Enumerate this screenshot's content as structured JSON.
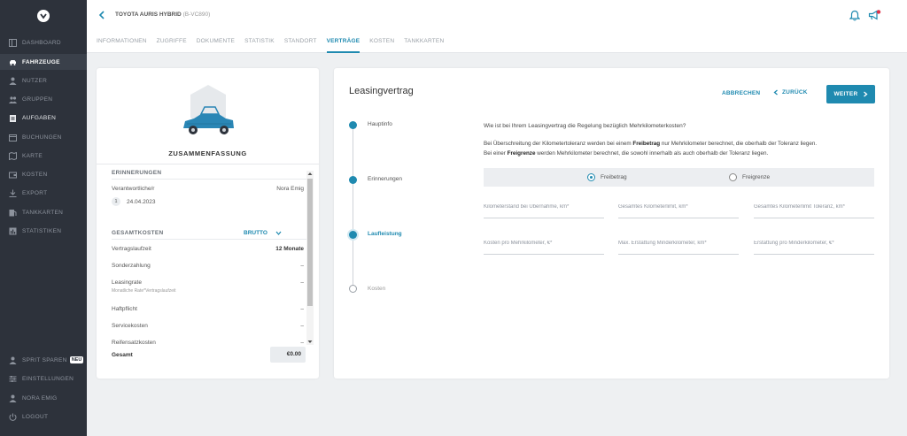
{
  "sidebar": {
    "items": [
      {
        "label": "DASHBOARD",
        "icon": "dashboard-icon"
      },
      {
        "label": "FAHRZEUGE",
        "icon": "car-icon"
      },
      {
        "label": "NUTZER",
        "icon": "user-icon"
      },
      {
        "label": "GRUPPEN",
        "icon": "group-icon"
      },
      {
        "label": "AUFGABEN",
        "icon": "clipboard-icon"
      },
      {
        "label": "BUCHUNGEN",
        "icon": "calendar-icon"
      },
      {
        "label": "KARTE",
        "icon": "map-icon"
      },
      {
        "label": "KOSTEN",
        "icon": "wallet-icon"
      },
      {
        "label": "EXPORT",
        "icon": "download-icon"
      },
      {
        "label": "TANKKARTEN",
        "icon": "fuel-card-icon"
      },
      {
        "label": "STATISTIKEN",
        "icon": "chart-icon"
      }
    ],
    "bottom": [
      {
        "label": "SPRIT SPAREN",
        "badge": "NEU",
        "icon": "user-icon"
      },
      {
        "label": "EINSTELLUNGEN",
        "icon": "sliders-icon"
      },
      {
        "label": "NORA EMIG",
        "icon": "user-icon"
      },
      {
        "label": "LOGOUT",
        "icon": "power-icon"
      }
    ]
  },
  "header": {
    "vehicle": "TOYOTA AURIS HYBRID",
    "plate": "(B-VC890)",
    "tabs": [
      "INFORMATIONEN",
      "ZUGRIFFE",
      "DOKUMENTE",
      "STATISTIK",
      "STANDORT",
      "VERTRÄGE",
      "KOSTEN",
      "TANKKARTEN"
    ],
    "active_tab": "VERTRÄGE"
  },
  "summary": {
    "title": "ZUSAMMENFASSUNG",
    "reminders_heading": "ERINNERUNGEN",
    "responsible_label": "Verantwortliche/r",
    "responsible_value": "Nora Emig",
    "reminder_count": "1",
    "reminder_date": "24.04.2023",
    "costs_heading": "GESAMTKOSTEN",
    "brutto_label": "BRUTTO",
    "rows": [
      {
        "label": "Vertragslaufzeit",
        "value": "12 Monate"
      },
      {
        "label": "Sonderzahlung",
        "value": "–"
      },
      {
        "label": "Leasingrate",
        "value": "–",
        "sub": "Monatliche Rate*Vertragslaufzeit"
      },
      {
        "label": "Haftpflicht",
        "value": "–"
      },
      {
        "label": "Servicekosten",
        "value": "–"
      },
      {
        "label": "Reifensatzkosten",
        "value": "–"
      }
    ],
    "total_label": "Gesamt",
    "total_value": "€0.00"
  },
  "lease": {
    "title": "Leasingvertrag",
    "cancel_label": "ABBRECHEN",
    "back_label": "ZURÜCK",
    "next_label": "WEITER",
    "steps": [
      "Hauptinfo",
      "Erinnerungen",
      "Laufleistung",
      "Kosten"
    ],
    "current_step": "Laufleistung",
    "question": "Wie ist bei Ihrem Leasingvertrag die Regelung bezüglich Mehrkilometerkosten?",
    "explain_1_a": "Bei Überschreitung der Kilometertoleranz werden bei einem ",
    "explain_1_b": "Freibetrag",
    "explain_1_c": " nur Mehrkilometer berechnet, die oberhalb der Toleranz liegen.",
    "explain_2_a": "Bei einer ",
    "explain_2_b": "Freigrenze",
    "explain_2_c": " werden Mehrkilometer berechnet, die sowohl innerhalb als auch oberhalb der Toleranz liegen.",
    "radio_options": [
      "Freibetrag",
      "Freigrenze"
    ],
    "radio_selected": "Freibetrag",
    "fields": [
      {
        "placeholder": "Kilometerstand bei Übernahme, km*",
        "value": ""
      },
      {
        "placeholder": "Gesamtes Kilometerlimit, km*",
        "value": ""
      },
      {
        "placeholder": "Gesamtes Kilometerlimit Toleranz, km*",
        "value": ""
      },
      {
        "placeholder": "Kosten pro Mehrkilometer, €*",
        "value": ""
      },
      {
        "placeholder": "Max. Erstattung Minderkilometer, km*",
        "value": ""
      },
      {
        "placeholder": "Erstattung pro Minderkilometer, €*",
        "value": ""
      }
    ]
  },
  "colors": {
    "accent": "#1f8ab0",
    "sidebar": "#2d323b",
    "car": "#2a86b5",
    "notification": "#e0344a"
  }
}
